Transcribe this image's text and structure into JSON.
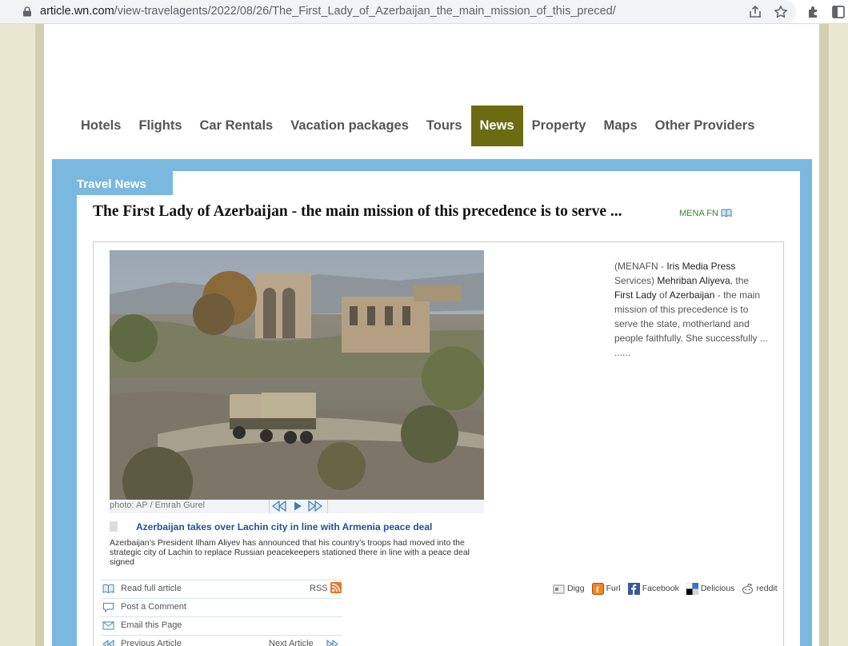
{
  "browser": {
    "url_host": "article.wn.com",
    "url_path": "/view-travelagents/2022/08/26/The_First_Lady_of_Azerbaijan_the_main_mission_of_this_preced/"
  },
  "nav": {
    "items": [
      "Hotels",
      "Flights",
      "Car Rentals",
      "Vacation packages",
      "Tours",
      "News",
      "Property",
      "Maps",
      "Other Providers"
    ],
    "active": "News"
  },
  "section_tab": "Travel News",
  "article": {
    "headline": "The First Lady of Azerbaijan - the main mission of this precedence is to serve ...",
    "source": "MENA FN",
    "photo_credit": "photo: AP / Emrah Gurel",
    "summary_parts": [
      {
        "text": "(MENAFN - ",
        "dark": false
      },
      {
        "text": "Iris Media Press",
        "dark": true
      },
      {
        "text": " Services) ",
        "dark": false
      },
      {
        "text": "Mehriban Aliyeva",
        "dark": true
      },
      {
        "text": ", the ",
        "dark": false
      },
      {
        "text": "First Lady",
        "dark": true
      },
      {
        "text": " of ",
        "dark": false
      },
      {
        "text": "Azerbaijan",
        "dark": true
      },
      {
        "text": " - the main mission of this precedence is to serve the state, motherland and people faithfully. She successfully ... ......",
        "dark": false
      }
    ]
  },
  "related": {
    "title": "Azerbaijan takes over Lachin city in line with Armenia peace deal",
    "description": "Azerbaijan’s President Ilham Aliyev has announced that his country’s troops had moved into the strategic city of Lachin to replace Russian peacekeepers stationed there in line with a peace deal signed"
  },
  "actions": {
    "read_full": "Read full article",
    "rss": "RSS",
    "post_comment": "Post a Comment",
    "email_page": "Email this Page",
    "previous": "Previous Article",
    "next": "Next Article"
  },
  "social": [
    "Digg",
    "Furl",
    "Facebook",
    "Delicious",
    "reddit"
  ],
  "colors": {
    "nav_active": "#6b6b12",
    "panel_blue": "#7ab8e0",
    "source_green": "#2e8b2e",
    "related_link": "#1f4f9f"
  }
}
